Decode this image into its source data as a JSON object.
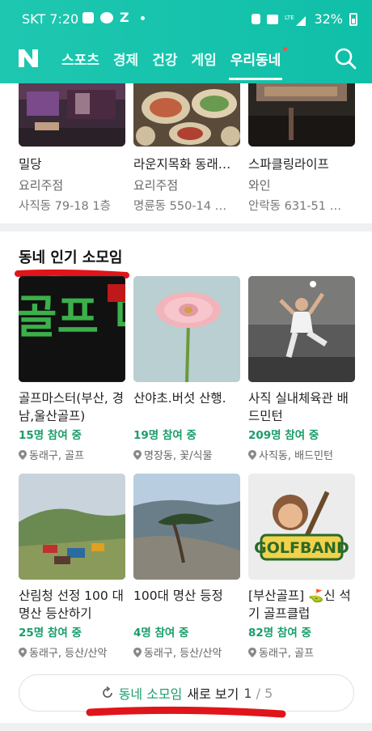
{
  "status_bar": {
    "carrier_time": "SKT 7:20",
    "battery": "32%"
  },
  "nav": {
    "logo": "N",
    "tabs": [
      {
        "label": "스포츠"
      },
      {
        "label": "경제"
      },
      {
        "label": "건강"
      },
      {
        "label": "게임"
      },
      {
        "label": "우리동네"
      }
    ],
    "active_tab": "우리동네"
  },
  "places": [
    {
      "name": "밀당",
      "category": "요리주점",
      "address": "사직동 79-18 1층"
    },
    {
      "name": "라운지목화 동래…",
      "category": "요리주점",
      "address": "명륜동 550-14 …"
    },
    {
      "name": "스파클링라이프",
      "category": "와인",
      "address": "안락동 631-51 …"
    }
  ],
  "clubs_section": {
    "title": "동네 인기 소모임",
    "clubs": [
      {
        "title": "골프마스터(부산, 경남,울산골프)",
        "members": "15명 참여 중",
        "location": "동래구, 골프",
        "thumb_text": "골프 마스터"
      },
      {
        "title": "산야초.버섯 산행.",
        "members": "19명 참여 중",
        "location": "명장동, 꽃/식물"
      },
      {
        "title": "사직 실내체육관 배드민턴",
        "members": "209명 참여 중",
        "location": "사직동, 배드민턴"
      },
      {
        "title": "산림청 선정 100 대 명산 등산하기",
        "members": "25명 참여 중",
        "location": "동래구, 등산/산악"
      },
      {
        "title": "100대 명산 등정",
        "members": "4명 참여 중",
        "location": "동래구, 등산/산악"
      },
      {
        "title": "[부산골프] ⛳신 석기 골프클럽",
        "members": "82명 참여 중",
        "location": "동래구, 골프",
        "thumb_text": "GOLFBAND"
      }
    ]
  },
  "more_button": {
    "accent": "동네 소모임",
    "label": "새로 보기",
    "page": "1",
    "total": " / 5"
  },
  "colors": {
    "brand": "#10bfa8",
    "member_green": "#1a9e6a",
    "annotation_red": "#e0151a"
  }
}
